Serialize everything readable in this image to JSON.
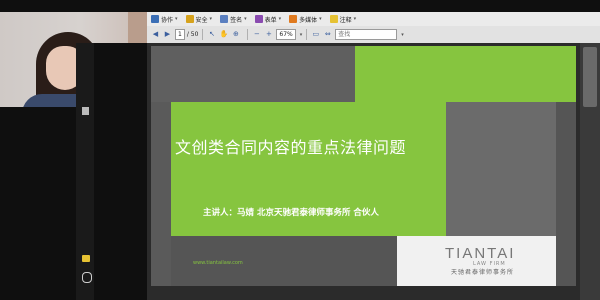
{
  "toolbar": {
    "menu": [
      {
        "label": "协作",
        "icon": "collaborate-icon",
        "color": "#3b6fb6"
      },
      {
        "label": "安全",
        "icon": "lock-icon",
        "color": "#d6a21c"
      },
      {
        "label": "签名",
        "icon": "pen-icon",
        "color": "#5a7fc0"
      },
      {
        "label": "表单",
        "icon": "form-icon",
        "color": "#8a4bb0"
      },
      {
        "label": "多媒体",
        "icon": "media-icon",
        "color": "#e07a1f"
      },
      {
        "label": "注释",
        "icon": "comment-icon",
        "color": "#e6c233"
      }
    ]
  },
  "navbar": {
    "current_page": "1",
    "total_pages": "/ 50",
    "zoom": "67%",
    "search_placeholder": "查找"
  },
  "slide": {
    "title": "文创类合同内容的重点法律问题",
    "speaker": "主讲人：马婧   北京天驰君泰律师事务所   合伙人",
    "website": "www.tiantailaw.com",
    "logo_main": "TIANTAI",
    "logo_sub": "LAW FIRM",
    "logo_cn": "天驰君泰律师事务所",
    "colors": {
      "green": "#86c53f",
      "dark": "#555555",
      "mid": "#6b6b6b",
      "light": "#f0f0f0"
    }
  }
}
